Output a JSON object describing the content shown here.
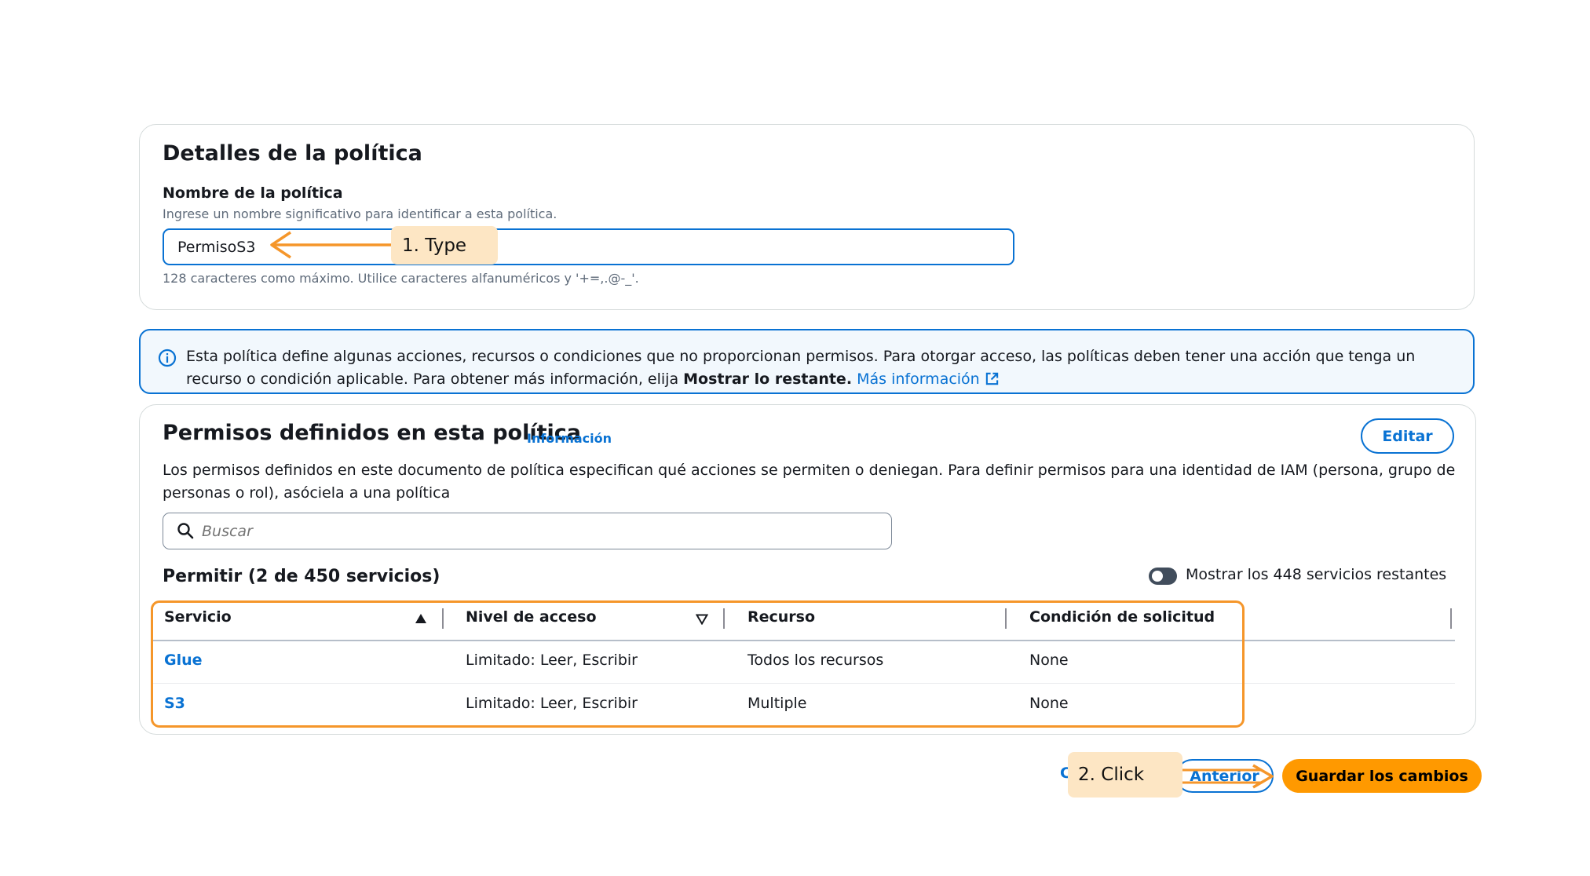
{
  "policy_details": {
    "title": "Detalles de la política",
    "name_label": "Nombre de la política",
    "name_description": "Ingrese un nombre significativo para identificar a esta política.",
    "name_value": "PermisoS3",
    "name_hint": "128 caracteres como máximo. Utilice caracteres alfanuméricos y '+=,.@-_'."
  },
  "alert": {
    "text": "Esta política define algunas acciones, recursos o condiciones que no proporcionan permisos. Para otorgar acceso, las políticas deben tener una acción que tenga un recurso o condición aplicable. Para obtener más información, elija",
    "bold_text": "Mostrar lo restante.",
    "link": "Más información",
    "icon": "info-icon"
  },
  "permissions": {
    "title": "Permisos definidos en esta política",
    "info_link": "Información",
    "edit_button": "Editar",
    "description": "Los permisos definidos en este documento de política especifican qué acciones se permiten o deniegan. Para definir permisos para una identidad de IAM (persona, grupo de personas o rol), asóciela a una política",
    "search_placeholder": "Buscar",
    "allow_heading": "Permitir (2 de 450 servicios)",
    "toggle_label": "Mostrar los 448 servicios restantes",
    "toggle_on": false,
    "columns": [
      "Servicio",
      "Nivel de acceso",
      "Recurso",
      "Condición de solicitud"
    ],
    "rows": [
      {
        "service": "Glue",
        "access": "Limitado: Leer, Escribir",
        "resource": "Todos los recursos",
        "condition": "None"
      },
      {
        "service": "S3",
        "access": "Limitado: Leer, Escribir",
        "resource": "Multiple",
        "condition": "None"
      }
    ]
  },
  "footer": {
    "cancel": "C",
    "previous": "Anterior",
    "save": "Guardar los cambios"
  },
  "annotations": {
    "step1": "1. Type",
    "step2": "2. Click",
    "color": "#f5962a"
  }
}
